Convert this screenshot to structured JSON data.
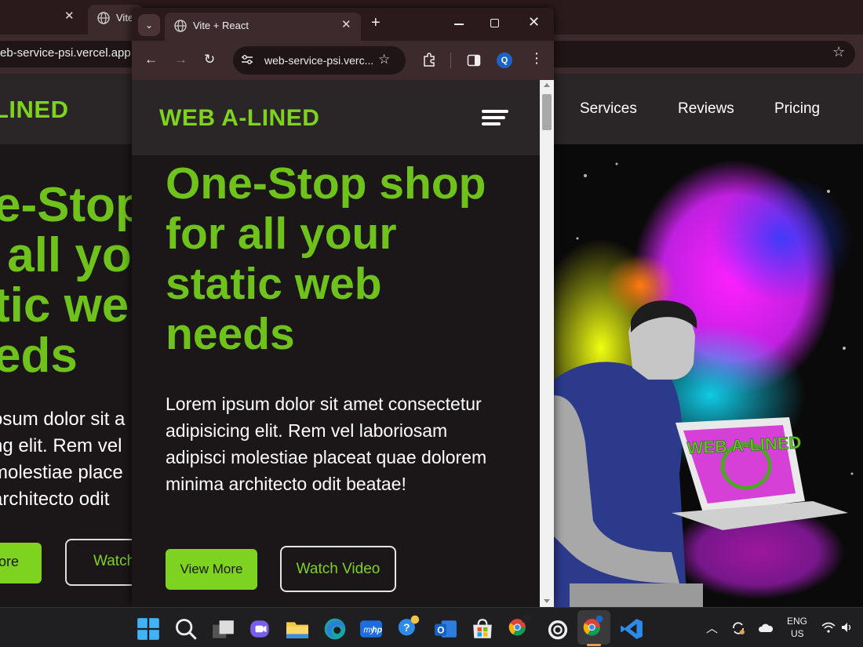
{
  "background_window": {
    "tab_title": "Vite",
    "url": "eb-service-psi.vercel.app",
    "site": {
      "logo": "LINED",
      "nav": [
        "Services",
        "Reviews",
        "Pricing"
      ],
      "hero_lines": [
        "e-Stop",
        " all yo",
        "tic we",
        "eds"
      ],
      "paragraph_lines": [
        "osum dolor sit a",
        "ng elit. Rem vel",
        "molestiae place",
        "architecto odit"
      ],
      "btn_primary": "ore",
      "btn_secondary": "Watch",
      "laptop_text": "WEB A-LINED"
    }
  },
  "foreground_window": {
    "tab_title": "Vite + React",
    "url": "web-service-psi.verc...",
    "avatar_letter": "Q",
    "site": {
      "logo": "WEB A-LINED",
      "hero": "One-Stop shop for all your static web needs",
      "paragraph": "Lorem ipsum dolor sit amet consectetur adipisicing elit. Rem vel laboriosam adipisci molestiae placeat quae dolorem minima architecto odit beatae!",
      "btn_primary": "View More",
      "btn_secondary": "Watch Video"
    }
  },
  "taskbar": {
    "language": "ENG",
    "region": "US"
  },
  "colors": {
    "brand_green": "#7ed321",
    "hero_green": "#6fc21c",
    "page_bg": "#1b1618",
    "nav_bg": "#2a2527",
    "chrome_frame": "#3d2a2c"
  }
}
